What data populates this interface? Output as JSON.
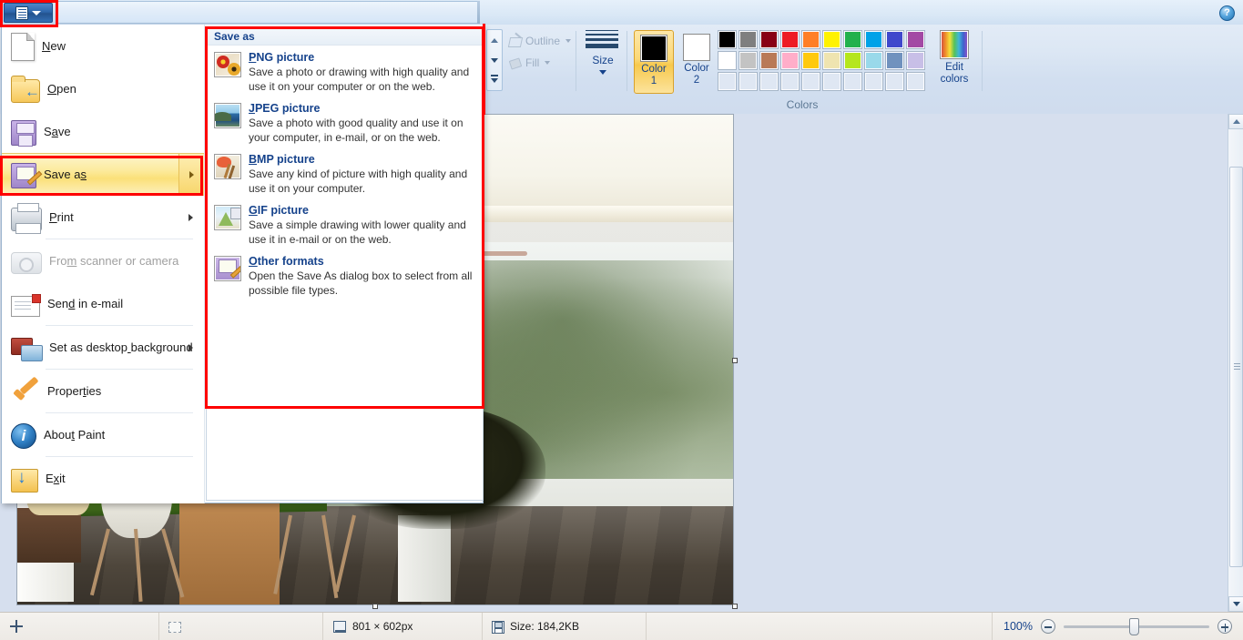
{
  "window": {
    "app_name": "Paint",
    "help_icon": "help-icon",
    "paint_menu_button": "paint-menu-button"
  },
  "ribbon": {
    "shape_tools": [
      {
        "label": "Outline",
        "icon": "pencil-outline-icon",
        "disabled": true
      },
      {
        "label": "Fill",
        "icon": "paint-bucket-icon",
        "disabled": true
      }
    ],
    "size": {
      "label": "Size",
      "icon": "line-sizes-icon"
    },
    "color1": {
      "label_line1": "Color",
      "label_line2": "1",
      "value": "#000000"
    },
    "color2": {
      "label_line1": "Color",
      "label_line2": "2",
      "value": "#ffffff"
    },
    "edit_colors": {
      "label_line1": "Edit",
      "label_line2": "colors",
      "icon": "color-spectrum-icon"
    },
    "group_label": "Colors",
    "palette": {
      "row1": [
        "#000000",
        "#7f7f7f",
        "#880015",
        "#ed1c24",
        "#ff7f27",
        "#fff200",
        "#22b14c",
        "#00a2e8",
        "#3f48cc",
        "#a349a4"
      ],
      "row2": [
        "#ffffff",
        "#c3c3c3",
        "#b97a57",
        "#ffaec9",
        "#ffc90e",
        "#efe4b0",
        "#b5e61d",
        "#99d9ea",
        "#7092be",
        "#c8bfe7"
      ],
      "row3": [
        "#dfe7f3",
        "#dfe7f3",
        "#dfe7f3",
        "#dfe7f3",
        "#dfe7f3",
        "#dfe7f3",
        "#dfe7f3",
        "#dfe7f3",
        "#dfe7f3",
        "#dfe7f3"
      ]
    }
  },
  "file_menu": {
    "items": [
      {
        "label": "New",
        "icon": "new-document-icon",
        "disabled": false,
        "has_submenu": false,
        "selected": false
      },
      {
        "label": "Open",
        "icon": "open-folder-icon",
        "disabled": false,
        "has_submenu": false,
        "selected": false
      },
      {
        "label": "Save",
        "icon": "floppy-disk-icon",
        "disabled": false,
        "has_submenu": false,
        "selected": false
      },
      {
        "label": "Save as",
        "icon": "save-as-icon",
        "disabled": false,
        "has_submenu": true,
        "selected": true
      },
      {
        "label": "Print",
        "icon": "printer-icon",
        "disabled": false,
        "has_submenu": true,
        "selected": false
      },
      {
        "label": "From scanner or camera",
        "icon": "scanner-camera-icon",
        "disabled": true,
        "has_submenu": false,
        "selected": false
      },
      {
        "label": "Send in e-mail",
        "icon": "envelope-icon",
        "disabled": false,
        "has_submenu": false,
        "selected": false
      },
      {
        "label": "Set as desktop background",
        "icon": "desktop-monitors-icon",
        "disabled": false,
        "has_submenu": true,
        "selected": false
      },
      {
        "label": "Properties",
        "icon": "orange-check-icon",
        "disabled": false,
        "has_submenu": false,
        "selected": false
      },
      {
        "label": "About Paint",
        "icon": "info-circle-icon",
        "disabled": false,
        "has_submenu": false,
        "selected": false
      },
      {
        "label": "Exit",
        "icon": "exit-folder-icon",
        "disabled": false,
        "has_submenu": false,
        "selected": false
      }
    ]
  },
  "save_as_submenu": {
    "header": "Save as",
    "items": [
      {
        "title": "PNG picture",
        "description": "Save a photo or drawing with high quality and use it on your computer or on the web.",
        "icon": "png-flowers-icon"
      },
      {
        "title": "JPEG picture",
        "description": "Save a photo with good quality and use it on your computer, in e-mail, or on the web.",
        "icon": "jpeg-landscape-icon"
      },
      {
        "title": "BMP picture",
        "description": "Save any kind of picture with high quality and use it on your computer.",
        "icon": "bmp-palette-icon"
      },
      {
        "title": "GIF picture",
        "description": "Save a simple drawing with lower quality and use it in e-mail or on the web.",
        "icon": "gif-drawing-icon"
      },
      {
        "title": "Other formats",
        "description": "Open the Save As dialog box to select from all possible file types.",
        "icon": "other-formats-floppy-icon"
      }
    ]
  },
  "status_bar": {
    "cursor_position": "",
    "selection_size": "",
    "image_dimensions": "801 × 602px",
    "file_size": "Size: 184,2KB",
    "zoom_level": "100%",
    "zoom_out_label": "zoom-out",
    "zoom_in_label": "zoom-in"
  },
  "annotations": {
    "highlight_color": "#fe0000",
    "boxes": [
      "paint-menu-button",
      "save-as-menu-item",
      "save-as-submenu-panel"
    ]
  }
}
